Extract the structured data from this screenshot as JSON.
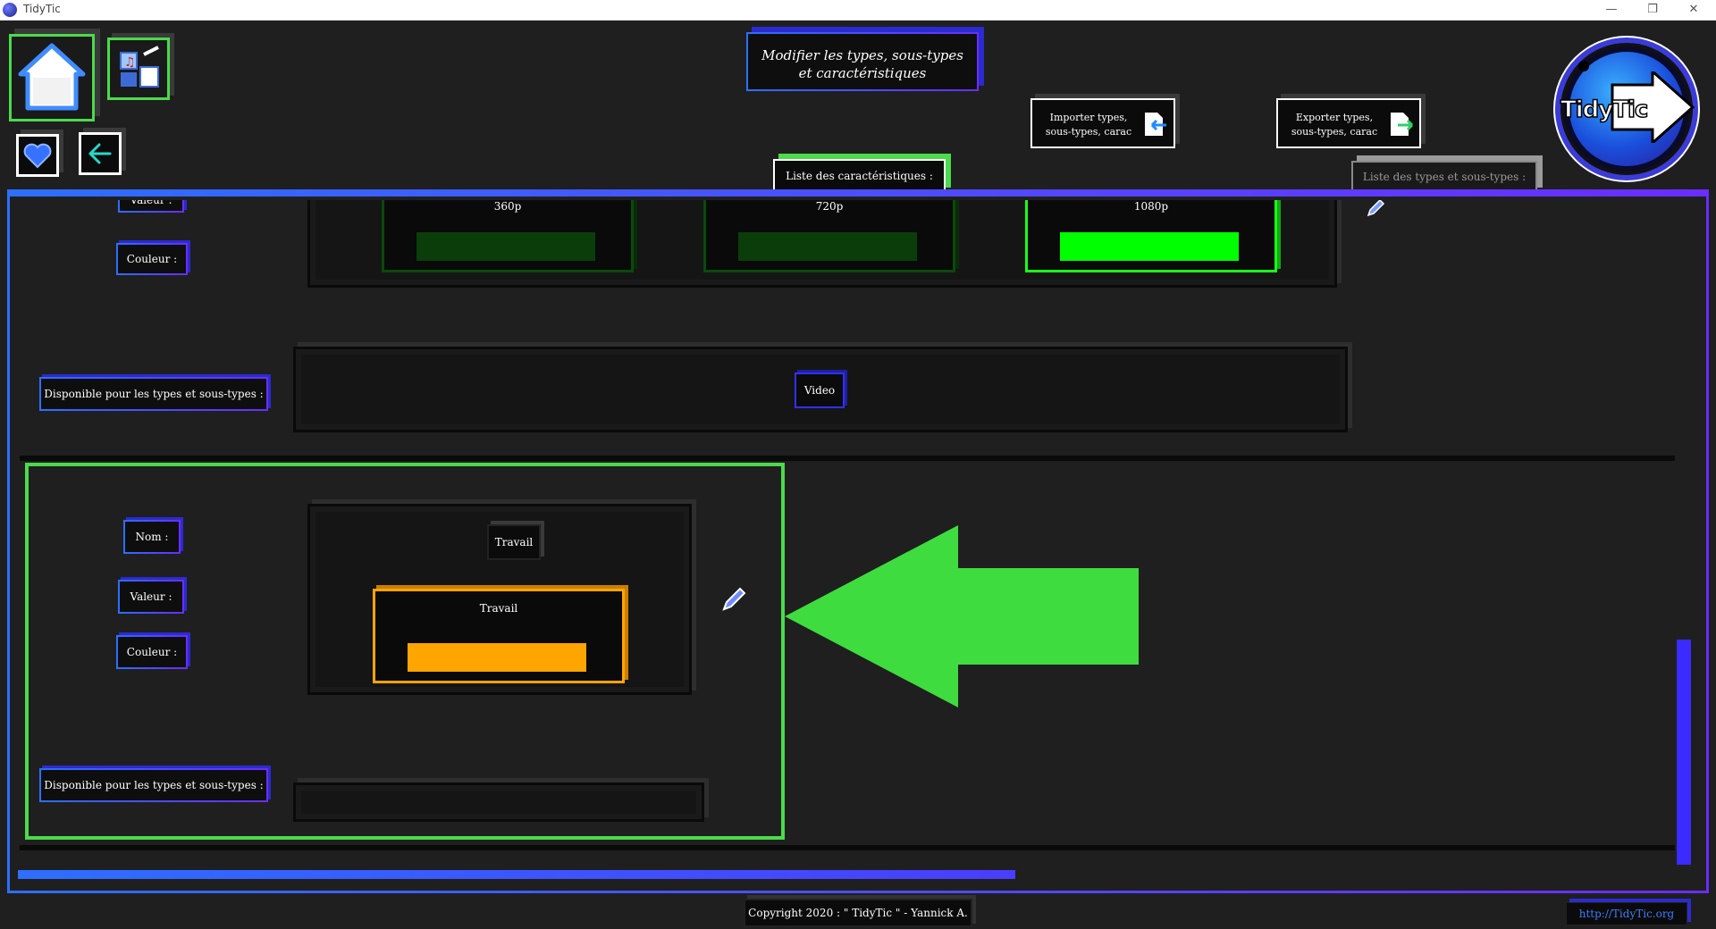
{
  "window": {
    "title": "TidyTic"
  },
  "header": {
    "page_title_line1": "Modifier les types, sous-types",
    "page_title_line2": "et caractéristiques",
    "import_label_line1": "Importer types,",
    "import_label_line2": "sous-types, carac",
    "export_label_line1": "Exporter types,",
    "export_label_line2": "sous-types, carac",
    "logo_text": "TidyTic"
  },
  "tabs": [
    {
      "label": "Liste des caractéristiques :",
      "active": true
    },
    {
      "label": "Liste des types et sous-types :",
      "active": false
    }
  ],
  "labels": {
    "valeur": "Valeur :",
    "couleur": "Couleur :",
    "nom": "Nom :",
    "disponible": "Disponible pour les types et sous-types :"
  },
  "resolution_block": {
    "options": [
      {
        "label": "360p",
        "color": "#0b3d0b",
        "selected": false
      },
      {
        "label": "720p",
        "color": "#0b3d0b",
        "selected": false
      },
      {
        "label": "1080p",
        "color": "#00ff00",
        "selected": true
      }
    ],
    "available_types": [
      "Video"
    ]
  },
  "new_block": {
    "name_value": "Travail",
    "value_label": "Travail",
    "color": "#ffa500",
    "available_types": []
  },
  "scroll": {
    "horizontal_fraction": 0.6,
    "vertical_fraction": 0.34
  },
  "footer": {
    "copyright": "Copyright 2020 : \" TidyTic \" - Yannick A.",
    "url": "http://TidyTic.org"
  },
  "colors": {
    "accent_green": "#4bdb4b",
    "accent_blue": "#2d6fff",
    "accent_purple": "#6a2dff",
    "orange": "#ffa500"
  }
}
